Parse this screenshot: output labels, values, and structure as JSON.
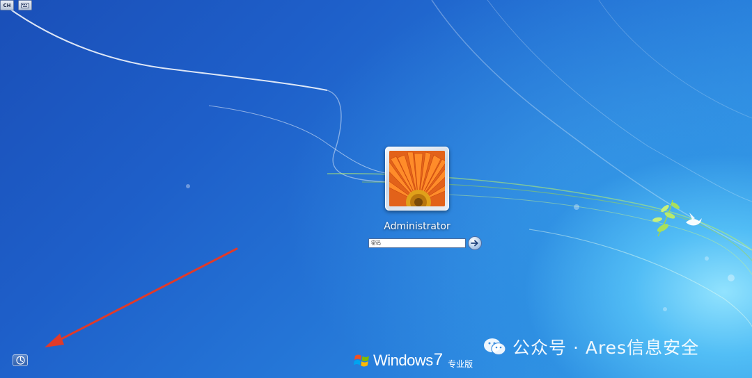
{
  "toolbar": {
    "keyboard_layout_label": "CH"
  },
  "logon": {
    "username": "Administrator",
    "password_placeholder": "密码"
  },
  "branding": {
    "product_name": "Windows",
    "version": "7",
    "edition": "专业版"
  },
  "watermark": {
    "text": "公众号 · Ares信息安全"
  },
  "colors": {
    "desktop_blue": "#1e5fc9",
    "glow_cyan": "#8fe3ff",
    "arrow_red": "#e03a2a",
    "leaf_green": "#9fd64a"
  },
  "icons": {
    "ease_of_access": "ease-of-access-icon",
    "submit": "arrow-right-icon",
    "keyboard": "keyboard-icon"
  }
}
